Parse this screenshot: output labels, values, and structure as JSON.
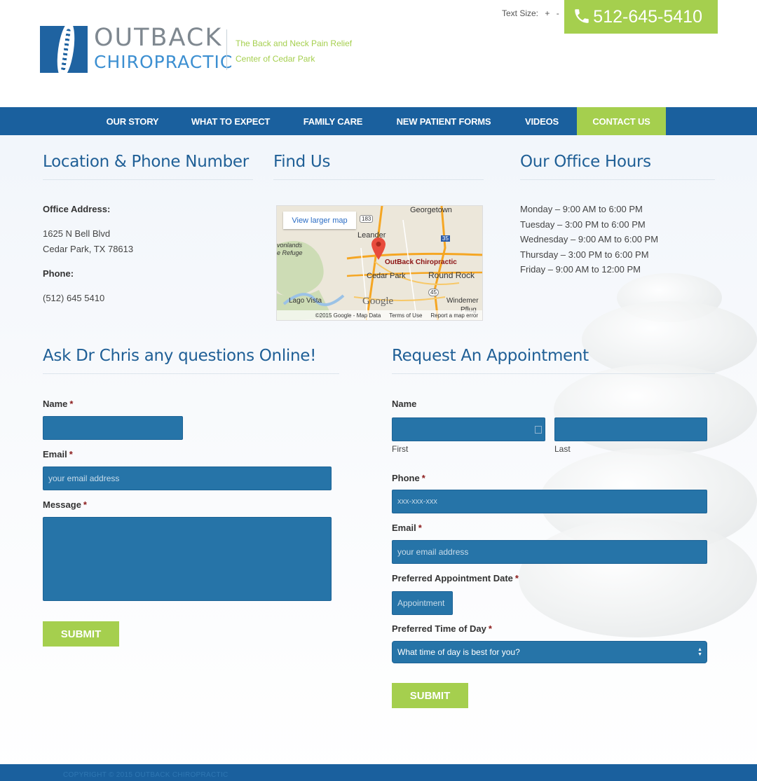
{
  "header": {
    "logo_line1": "OUTBACK",
    "logo_line2": "CHIROPRACTIC",
    "tagline_line1": "The Back and Neck Pain Relief",
    "tagline_line2": "Center of Cedar Park",
    "text_size_label": "Text Size:",
    "text_size_increase": "+",
    "text_size_decrease": "-",
    "phone": "512-645-5410"
  },
  "nav": {
    "items": [
      {
        "label": "OUR STORY"
      },
      {
        "label": "WHAT TO EXPECT"
      },
      {
        "label": "FAMILY CARE"
      },
      {
        "label": "NEW PATIENT FORMS"
      },
      {
        "label": "VIDEOS"
      },
      {
        "label": "CONTACT US"
      }
    ],
    "active": "CONTACT US"
  },
  "location": {
    "title": "Location & Phone Number",
    "address_label": "Office Address:",
    "address_line1": "1625 N Bell Blvd",
    "address_line2": "Cedar Park, TX 78613",
    "phone_label": "Phone:",
    "phone": "(512) 645 5410"
  },
  "find_us": {
    "title": "Find Us",
    "map_button": "View larger map",
    "marker_label": "OutBack Chiropractic",
    "places": [
      "Georgetown",
      "Leander",
      "Cedar Park",
      "Round Rock",
      "Lago Vista",
      "Windemer",
      "Pflug",
      "vonlands",
      "e Refuge"
    ],
    "roads": [
      "183",
      "35",
      "45"
    ],
    "map_brand": "Google",
    "footer_copyright": "©2015 Google - Map Data",
    "footer_terms": "Terms of Use",
    "footer_report": "Report a map error"
  },
  "hours": {
    "title": "Our Office Hours",
    "lines": [
      "Monday – 9:00 AM to 6:00 PM",
      "Tuesday – 3:00 PM to 6:00 PM",
      "Wednesday – 9:00 AM to 6:00 PM",
      "Thursday – 3:00 PM to 6:00 PM",
      "Friday – 9:00 AM to 12:00 PM"
    ]
  },
  "question_form": {
    "title": "Ask Dr Chris any questions Online!",
    "name_label": "Name",
    "email_label": "Email",
    "email_placeholder": "your email address",
    "message_label": "Message",
    "required_mark": "*",
    "submit_label": "SUBMIT"
  },
  "appointment_form": {
    "title": "Request An Appointment",
    "name_label": "Name",
    "first_label": "First",
    "last_label": "Last",
    "phone_label": "Phone",
    "phone_placeholder": "xxx-xxx-xxx",
    "email_label": "Email",
    "email_placeholder": "your email address",
    "date_label": "Preferred Appointment Date",
    "date_placeholder": "Appointment",
    "time_label": "Preferred Time of Day",
    "time_selected": "What time of day is best for you?",
    "required_mark": "*",
    "submit_label": "SUBMIT"
  },
  "footer": {
    "copyright": "COPYRIGHT © 2015 OUTBACK CHIROPRACTIC"
  },
  "colors": {
    "brand_blue": "#1a609e",
    "accent_green": "#a5cf4e",
    "field_blue": "#2674a8",
    "title_blue": "#1f5f96"
  }
}
